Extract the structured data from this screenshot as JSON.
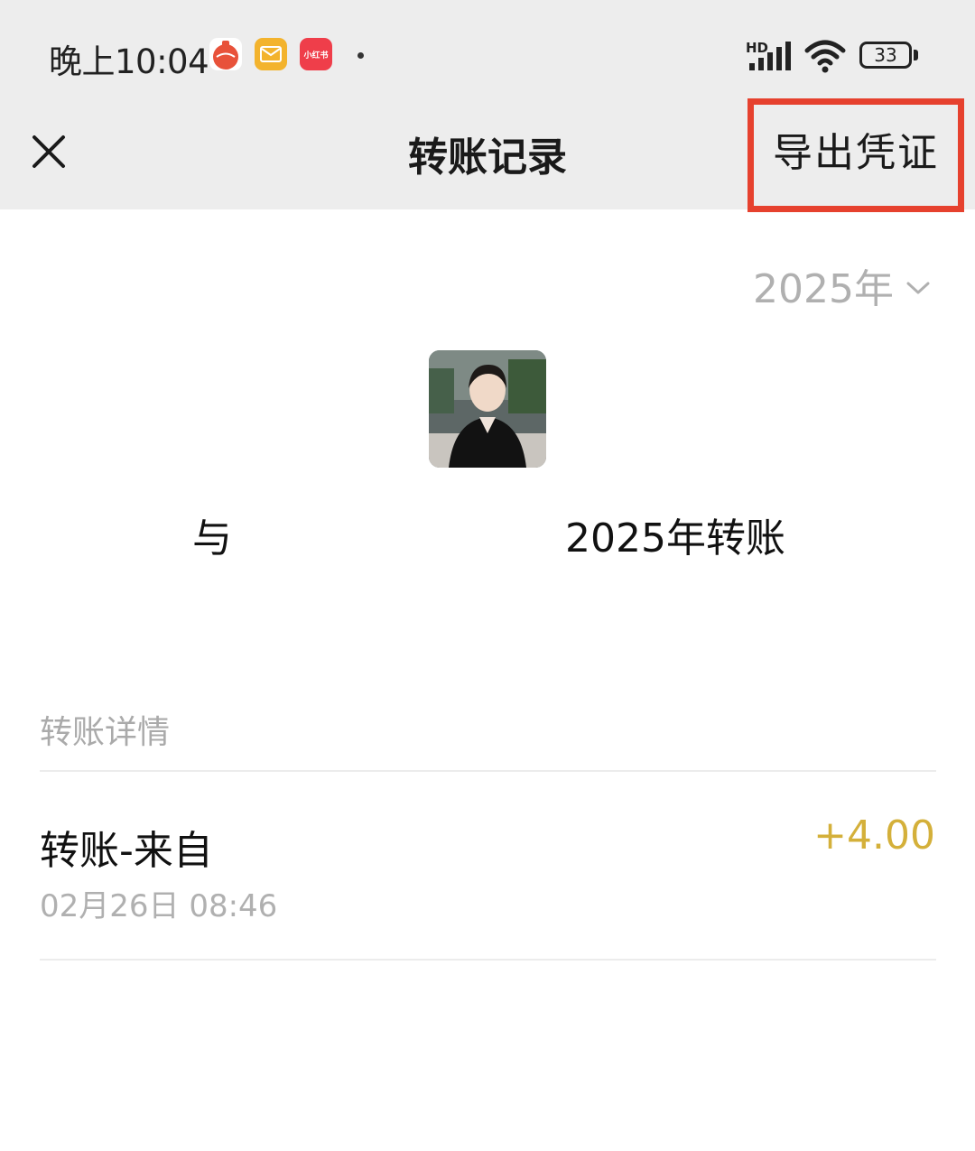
{
  "status_bar": {
    "time": "晚上10:04",
    "network_label": "HD",
    "battery": "33",
    "apps": [
      {
        "icon": "tomato-app-icon",
        "color": "#e8523a"
      },
      {
        "icon": "mail-app-icon",
        "color": "#f3b32d"
      },
      {
        "icon": "xiaohongshu-app-icon",
        "color": "#ef3e4a",
        "label": "小红书"
      }
    ]
  },
  "header": {
    "title": "转账记录",
    "export_label": "导出凭证",
    "close_icon": "close-icon"
  },
  "filter": {
    "year": "2025年",
    "chevron_icon": "chevron-down-icon"
  },
  "summary": {
    "prefix": "与",
    "suffix": "2025年转账"
  },
  "section": {
    "label": "转账详情"
  },
  "transactions": [
    {
      "title": "转账-来自",
      "date": "02月26日 08:46",
      "amount": "+4.00"
    }
  ],
  "colors": {
    "header_bg": "#ededed",
    "highlight_border": "#e6412e",
    "amount": "#d4b03a",
    "muted_text": "#b0b0b0"
  }
}
